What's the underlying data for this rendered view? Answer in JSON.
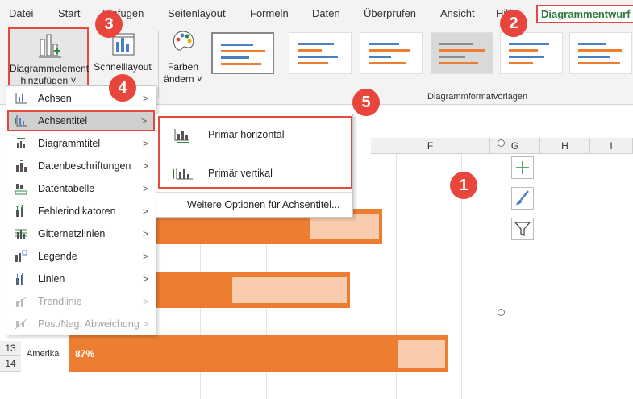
{
  "ribbon_tabs": [
    "Datei",
    "Start",
    "Einfügen",
    "Seitenlayout",
    "Formeln",
    "Daten",
    "Überprüfen",
    "Ansicht",
    "Hilfe",
    "Diagrammentwurf"
  ],
  "ribbon": {
    "add_element_line1": "Diagrammelement",
    "add_element_line2": "hinzufügen ˅",
    "quick_layout": "Schnelllayout",
    "colors_line1": "Farben",
    "colors_line2": "ändern ˅",
    "styles_group_label": "Diagrammformatvorlagen"
  },
  "menu_items": [
    {
      "label": "Achsen",
      "icon": "axes-icon",
      "enabled": true
    },
    {
      "label": "Achsentitel",
      "icon": "axis-title-icon",
      "enabled": true,
      "highlighted": true
    },
    {
      "label": "Diagrammtitel",
      "icon": "chart-title-icon",
      "enabled": true
    },
    {
      "label": "Datenbeschriftungen",
      "icon": "data-labels-icon",
      "enabled": true
    },
    {
      "label": "Datentabelle",
      "icon": "data-table-icon",
      "enabled": true
    },
    {
      "label": "Fehlerindikatoren",
      "icon": "error-bars-icon",
      "enabled": true
    },
    {
      "label": "Gitternetzlinien",
      "icon": "gridlines-icon",
      "enabled": true
    },
    {
      "label": "Legende",
      "icon": "legend-icon",
      "enabled": true
    },
    {
      "label": "Linien",
      "icon": "lines-icon",
      "enabled": true
    },
    {
      "label": "Trendlinie",
      "icon": "trendline-icon",
      "enabled": false
    },
    {
      "label": "Pos./Neg. Abweichung",
      "icon": "up-down-bars-icon",
      "enabled": false
    }
  ],
  "submenu": {
    "primary_horizontal": "Primär horizontal",
    "primary_vertical": "Primär vertikal",
    "more_options": "Weitere Optionen für Achsentitel..."
  },
  "sheet": {
    "columns": [
      "F",
      "G",
      "H",
      "I"
    ],
    "rows": [
      "13",
      "14"
    ],
    "category_america": "Amerika",
    "label_america": "87%"
  },
  "chart_data": {
    "type": "bar",
    "categories": [
      "",
      "",
      "Amerika"
    ],
    "series": [
      {
        "values": [
          null,
          null,
          0.87
        ]
      }
    ],
    "data_labels": [
      "",
      "",
      "87%"
    ]
  },
  "callouts": [
    "1",
    "2",
    "3",
    "4",
    "5"
  ],
  "colors": {
    "accent": "#ed7d31",
    "accent_light": "#f8cbad",
    "annotation_red": "#e8453c",
    "tab_green": "#2e7a3c"
  }
}
